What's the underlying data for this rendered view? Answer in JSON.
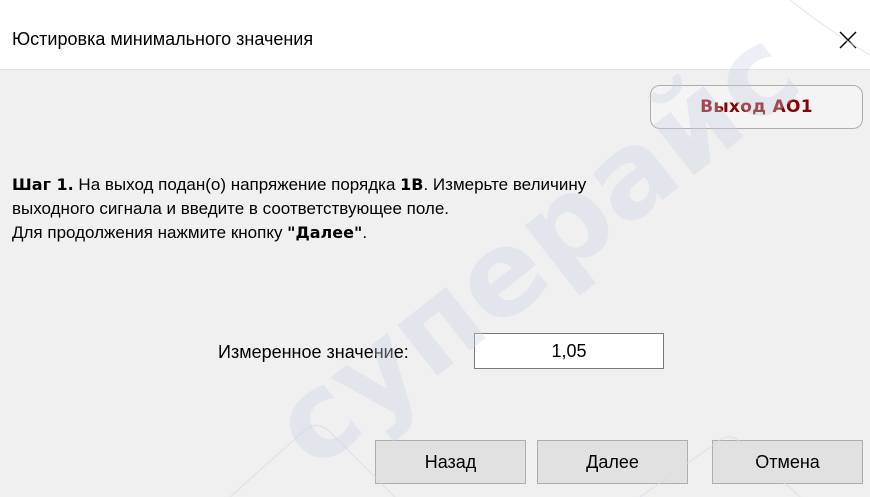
{
  "window": {
    "title": "Юстировка минимального значения",
    "close_icon": "close-icon"
  },
  "output_button": {
    "label": "Выход АО1",
    "color": "#8b0000"
  },
  "instructions": {
    "step_label": "Шаг 1.",
    "line1_a": " На выход подан(о) напряжение порядка ",
    "voltage": "1В",
    "line1_b": ". Измерьте величину",
    "line2": "выходного сигнала и введите в соответствующее поле.",
    "line3_a": "Для продолжения нажмите кнопку ",
    "next_quote": "\"Далее\"",
    "line3_b": "."
  },
  "measured": {
    "label": "Измеренное значение:",
    "value": "1,05"
  },
  "buttons": {
    "back": "Назад",
    "next": "Далее",
    "cancel": "Отмена"
  },
  "watermark": {
    "text": "суперайс"
  }
}
